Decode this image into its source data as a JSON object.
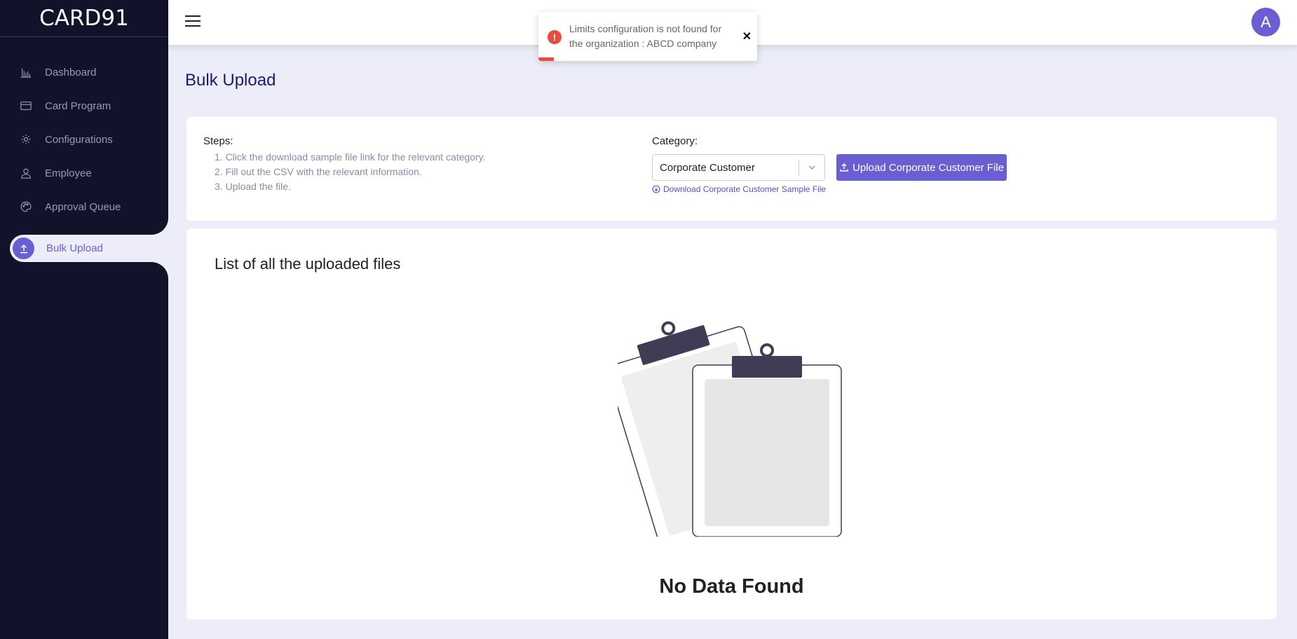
{
  "sidebar": {
    "logo": "CARD91",
    "items": [
      {
        "label": "Dashboard",
        "icon": "chart-icon"
      },
      {
        "label": "Card Program",
        "icon": "card-icon"
      },
      {
        "label": "Configurations",
        "icon": "gear-icon"
      },
      {
        "label": "Employee",
        "icon": "user-icon"
      },
      {
        "label": "Approval Queue",
        "icon": "palette-icon"
      },
      {
        "label": "Bulk Upload",
        "icon": "upload-icon",
        "active": true
      }
    ]
  },
  "header": {
    "avatar_initial": "A"
  },
  "toast": {
    "message": "Limits configuration is not found for the organization : ABCD company",
    "close": "✕",
    "type": "error"
  },
  "page": {
    "title": "Bulk Upload"
  },
  "steps": {
    "title": "Steps:",
    "items": [
      "1. Click the download sample file link for the relevant category.",
      "2. Fill out the CSV with the relevant information.",
      "3. Upload the file."
    ]
  },
  "category": {
    "label": "Category:",
    "selected": "Corporate Customer",
    "download_link": "Download Corporate Customer Sample File",
    "upload_button": "Upload Corporate Customer File"
  },
  "files": {
    "title": "List of all the uploaded files",
    "empty_text": "No Data Found"
  },
  "colors": {
    "accent": "#6a5fd2",
    "sidebar_bg": "#12122b",
    "page_bg": "#ecedf8",
    "error": "#e74c3c"
  }
}
